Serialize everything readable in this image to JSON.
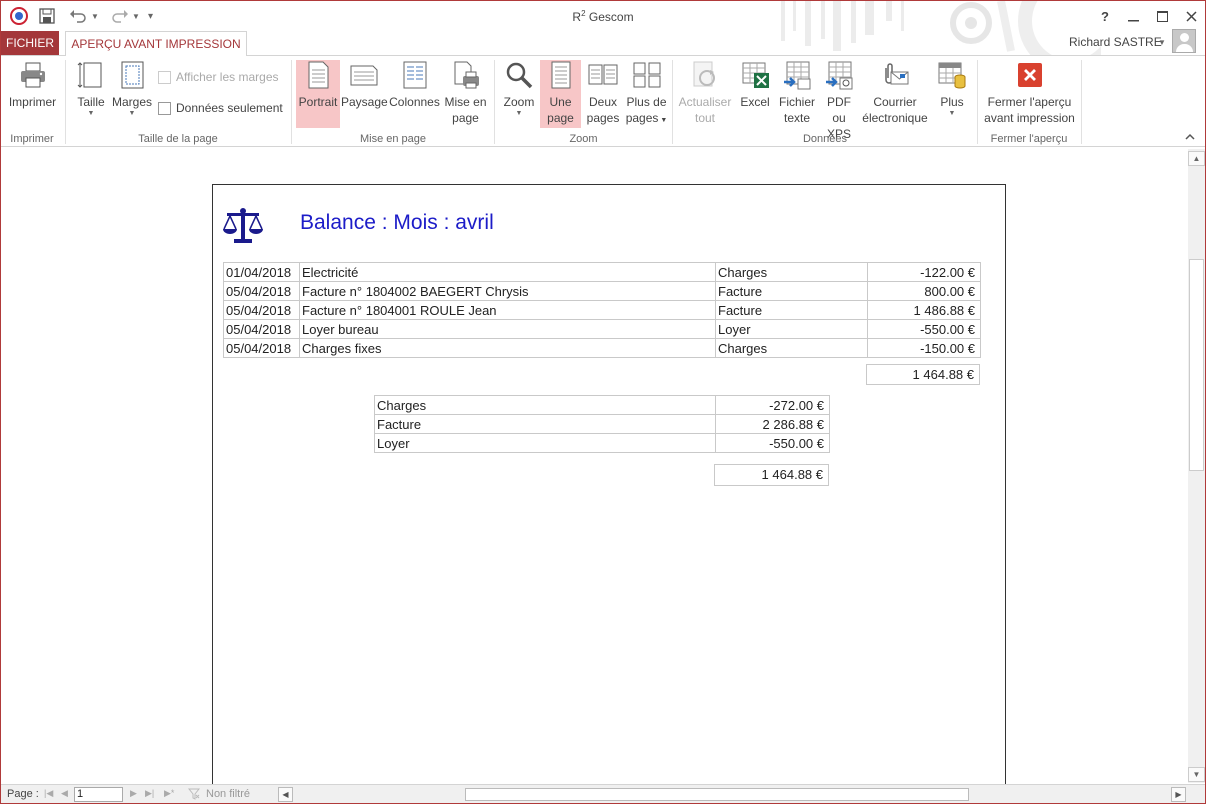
{
  "window": {
    "title": "R² Gescom",
    "user": "Richard SASTRE"
  },
  "tabs": {
    "file": "FICHIER",
    "preview": "APERÇU AVANT IMPRESSION"
  },
  "ribbon": {
    "groups": {
      "print": "Imprimer",
      "page_size": "Taille de la page",
      "layout": "Mise en page",
      "zoom": "Zoom",
      "data": "Données",
      "close": "Fermer l'aperçu"
    },
    "buttons": {
      "print": "Imprimer",
      "size": "Taille",
      "margins": "Marges",
      "show_margins": "Afficher les marges",
      "data_only": "Données seulement",
      "portrait": "Portrait",
      "landscape": "Paysage",
      "columns": "Colonnes",
      "page_setup_1": "Mise en",
      "page_setup_2": "page",
      "zoom": "Zoom",
      "one_page_1": "Une",
      "one_page_2": "page",
      "two_pages_1": "Deux",
      "two_pages_2": "pages",
      "more_pages_1": "Plus de",
      "more_pages_2": "pages",
      "refresh_1": "Actualiser",
      "refresh_2": "tout",
      "excel": "Excel",
      "text_1": "Fichier",
      "text_2": "texte",
      "pdf_1": "PDF",
      "pdf_2": "ou XPS",
      "email_1": "Courrier",
      "email_2": "électronique",
      "more": "Plus",
      "close_1": "Fermer l'aperçu",
      "close_2": "avant impression"
    }
  },
  "report": {
    "title": "Balance : Mois : avril",
    "rows": [
      {
        "date": "01/04/2018",
        "label": "Electricité",
        "category": "Charges",
        "amount": "-122.00 €"
      },
      {
        "date": "05/04/2018",
        "label": "Facture n° 1804002 BAEGERT Chrysis",
        "category": "Facture",
        "amount": "800.00 €"
      },
      {
        "date": "05/04/2018",
        "label": "Facture n° 1804001 ROULE Jean",
        "category": "Facture",
        "amount": "1 486.88 €"
      },
      {
        "date": "05/04/2018",
        "label": "Loyer bureau",
        "category": "Loyer",
        "amount": "-550.00 €"
      },
      {
        "date": "05/04/2018",
        "label": "Charges fixes",
        "category": "Charges",
        "amount": "-150.00 €"
      }
    ],
    "total": "1 464.88 €",
    "summary": [
      {
        "category": "Charges",
        "amount": "-272.00 €"
      },
      {
        "category": "Facture",
        "amount": "2 286.88 €"
      },
      {
        "category": "Loyer",
        "amount": "-550.00 €"
      }
    ],
    "summary_total": "1 464.88 €"
  },
  "status": {
    "page_label": "Page :",
    "page_value": "1",
    "filter": "Non filtré"
  }
}
